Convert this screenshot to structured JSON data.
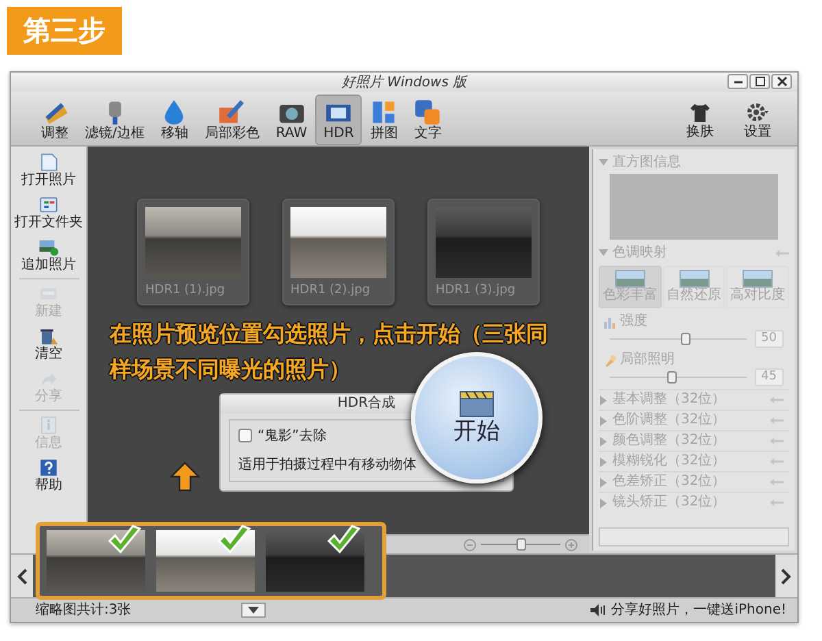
{
  "step_banner": "第三步",
  "window": {
    "title": "好照片 Windows 版"
  },
  "toolbar": {
    "tools": [
      {
        "label": "调整",
        "kind": "ruler",
        "selected": false
      },
      {
        "label": "滤镜/边框",
        "kind": "brush",
        "selected": false
      },
      {
        "label": "移轴",
        "kind": "drop",
        "selected": false
      },
      {
        "label": "局部彩色",
        "kind": "pen",
        "selected": false
      },
      {
        "label": "RAW",
        "kind": "camera",
        "selected": false
      },
      {
        "label": "HDR",
        "kind": "film",
        "selected": true
      },
      {
        "label": "拼图",
        "kind": "grid",
        "selected": false
      },
      {
        "label": "文字",
        "kind": "tiles",
        "selected": false
      }
    ],
    "right": [
      {
        "label": "换肤",
        "kind": "shirt"
      },
      {
        "label": "设置",
        "kind": "gear"
      }
    ]
  },
  "sidebar": {
    "items": [
      {
        "label": "打开照片",
        "kind": "page",
        "disabled": false
      },
      {
        "label": "打开文件夹",
        "kind": "folder",
        "disabled": false
      },
      {
        "label": "追加照片",
        "kind": "imageplus",
        "disabled": false
      },
      {
        "label": "新建",
        "kind": "card",
        "disabled": true
      },
      {
        "label": "清空",
        "kind": "trash",
        "disabled": false
      },
      {
        "label": "分享",
        "kind": "share",
        "disabled": true
      },
      {
        "label": "信息",
        "kind": "info",
        "disabled": true
      },
      {
        "label": "帮助",
        "kind": "help",
        "disabled": false
      }
    ]
  },
  "photos": [
    {
      "filename": "HDR1 (1).jpg",
      "kind": "normal"
    },
    {
      "filename": "HDR1 (2).jpg",
      "kind": "bright"
    },
    {
      "filename": "HDR1 (3).jpg",
      "kind": "dark"
    }
  ],
  "instruction": "在照片预览位置勾选照片，点击开始（三张同样场景不同曝光的照片）",
  "dialog": {
    "title": "HDR合成",
    "ghost_removal": {
      "label": "“鬼影”去除",
      "checked": false
    },
    "description": "适用于拍摄过程中有移动物体",
    "start_button": "开始"
  },
  "zoom": {
    "level": 0.5
  },
  "right_panel": {
    "disabled": true,
    "histogram": {
      "title": "直方图信息",
      "expanded": true
    },
    "tone_mapping": {
      "title": "色调映射",
      "expanded": true,
      "presets": [
        {
          "label": "色彩丰富",
          "selected": true
        },
        {
          "label": "自然还原",
          "selected": false
        },
        {
          "label": "高对比度",
          "selected": false
        }
      ],
      "sliders": [
        {
          "label": "强度",
          "kind": "bars",
          "level": 0.55,
          "reading": "50"
        },
        {
          "label": "局部照明",
          "kind": "torch",
          "level": 0.45,
          "reading": "45"
        }
      ]
    },
    "sections": [
      {
        "label": "基本调整（32位）",
        "expanded": false
      },
      {
        "label": "色阶调整（32位）",
        "expanded": false
      },
      {
        "label": "颜色调整（32位）",
        "expanded": false
      },
      {
        "label": "模糊锐化（32位）",
        "expanded": false
      },
      {
        "label": "色差矫正（32位）",
        "expanded": false
      },
      {
        "label": "镜头矫正（32位）",
        "expanded": false
      }
    ]
  },
  "filmstrip": {
    "photos": [
      {
        "kind": "normal",
        "checked": true
      },
      {
        "kind": "bright",
        "checked": true
      },
      {
        "kind": "dark",
        "checked": true
      }
    ]
  },
  "status_bar": {
    "count": "缩略图共计:3张",
    "promo": "分享好照片，一键送iPhone!"
  }
}
